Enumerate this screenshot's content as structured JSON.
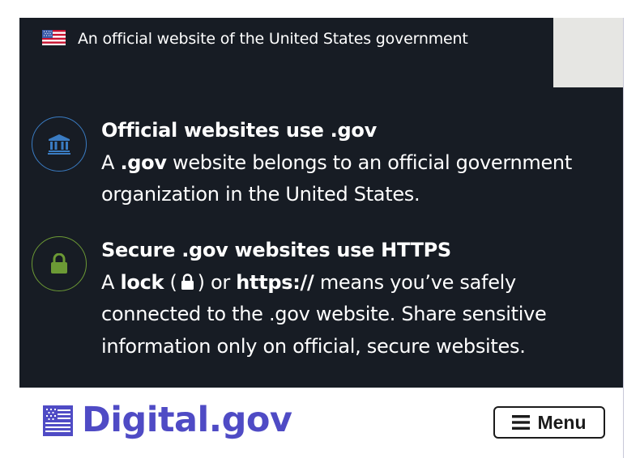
{
  "banner": {
    "flag_icon": "us-flag-icon",
    "text": "An official website of the United States government"
  },
  "gov_section": {
    "icon": "government-building-icon",
    "title": "Official websites use .gov",
    "line_prefix": "A ",
    "bold_term": ".gov",
    "line_rest": " website belongs to an official government organization in the United States."
  },
  "https_section": {
    "icon": "lock-icon",
    "title": "Secure .gov websites use HTTPS",
    "prefix": "A ",
    "lock_word": "lock",
    "paren_open": " (",
    "paren_close": ") or ",
    "https_word": "https://",
    "rest": " means you’ve safely connected to the .gov website. Share sensitive information only on official, secure websites."
  },
  "header": {
    "logo_icon": "digital-gov-flag-logo-icon",
    "logo_text": "Digital.gov",
    "menu_label": "Menu",
    "menu_icon": "hamburger-icon"
  },
  "colors": {
    "banner_bg": "#171c24",
    "gov_circle": "#3a7cc3",
    "https_circle": "#6c9a35",
    "logo": "#4f4bc5"
  }
}
